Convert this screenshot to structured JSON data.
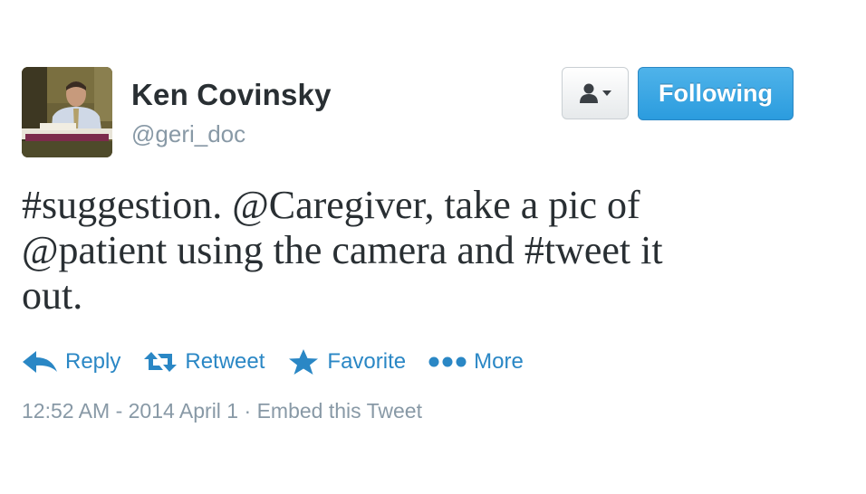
{
  "author": {
    "name": "Ken Covinsky",
    "handle": "@geri_doc",
    "avatar_icon": "profile-photo"
  },
  "header": {
    "user_menu_icon": "user-dropdown-icon",
    "follow_label": "Following",
    "follow_color": "#2b9cde"
  },
  "tweet": {
    "lines": [
      "#suggestion. @Caregiver, take a pic of",
      "@patient using the camera and #tweet it",
      "out."
    ]
  },
  "actions": [
    {
      "label": "Reply",
      "icon": "reply-icon"
    },
    {
      "label": "Retweet",
      "icon": "retweet-icon"
    },
    {
      "label": "Favorite",
      "icon": "star-icon"
    },
    {
      "label": "More",
      "icon": "more-dots-icon"
    }
  ],
  "meta": {
    "timestamp": "12:52 AM - 2014 April 1",
    "separator": "·",
    "embed_label": "Embed this Tweet"
  },
  "colors": {
    "link": "#2a87c5",
    "muted": "#8899a6",
    "text": "#292f33"
  }
}
